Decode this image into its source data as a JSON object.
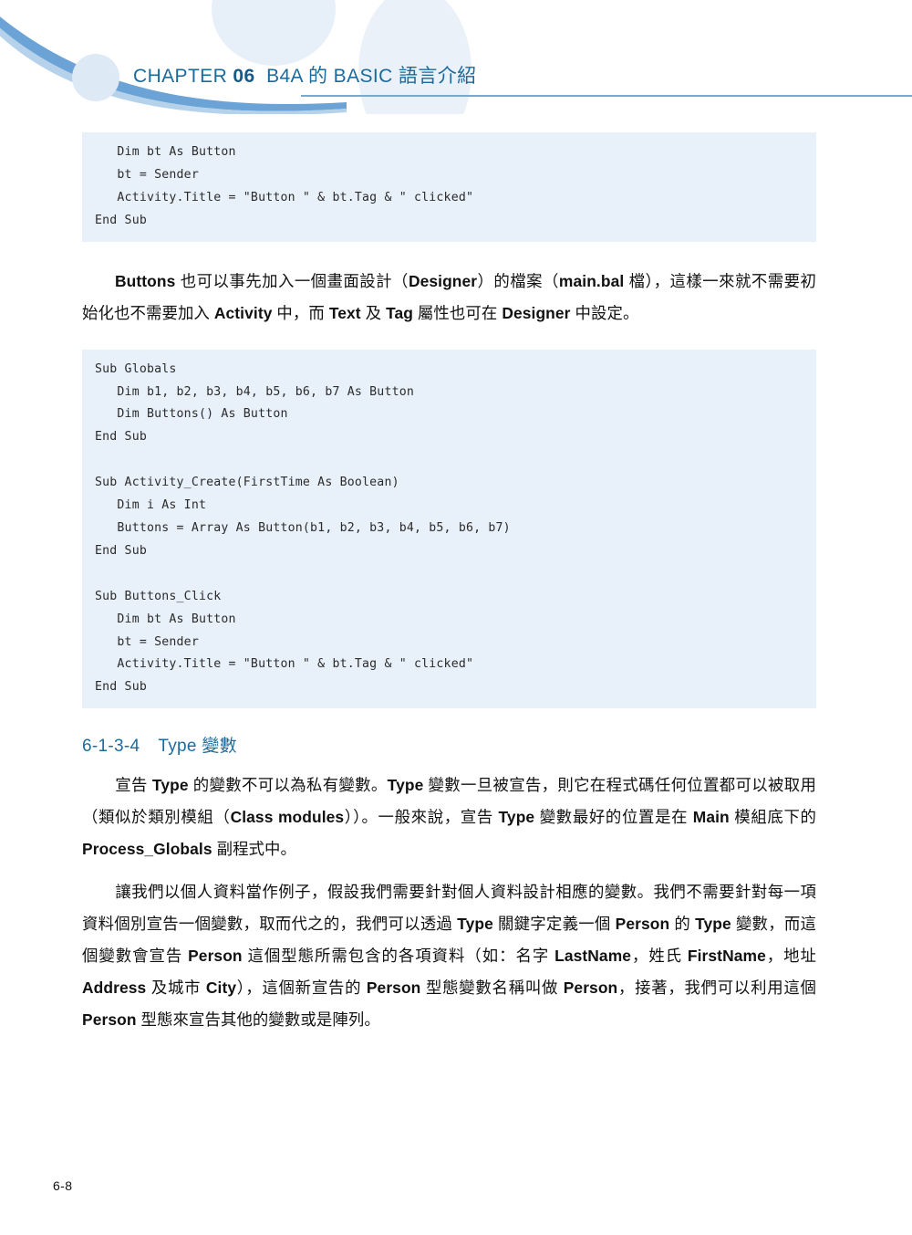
{
  "header": {
    "chapter_label": "CHAPTER",
    "chapter_number": "06",
    "chapter_title": "B4A 的 BASIC 語言介紹",
    "accent_color": "#1b6a9c",
    "rule_color": "#7ba9cc",
    "curve_color": "#6ba3d6",
    "circle_color": "#e3ecf6"
  },
  "code_block_1": {
    "background": "#e8f0f9",
    "lines": [
      "   Dim bt As Button",
      "   bt = Sender",
      "   Activity.Title = \"Button \" & bt.Tag & \" clicked\"",
      "End Sub"
    ]
  },
  "paragraph_1": {
    "segments": [
      {
        "text": "Buttons",
        "bold": true
      },
      {
        "text": " 也可以事先加入一個畫面設計（",
        "bold": false
      },
      {
        "text": "Designer",
        "bold": true
      },
      {
        "text": "）的檔案（",
        "bold": false
      },
      {
        "text": "main.bal",
        "bold": true
      },
      {
        "text": " 檔），這樣一來就不需要初始化也不需要加入 ",
        "bold": false
      },
      {
        "text": "Activity",
        "bold": true
      },
      {
        "text": " 中，而 ",
        "bold": false
      },
      {
        "text": "Text",
        "bold": true
      },
      {
        "text": " 及 ",
        "bold": false
      },
      {
        "text": "Tag",
        "bold": true
      },
      {
        "text": " 屬性也可在 ",
        "bold": false
      },
      {
        "text": "Designer",
        "bold": true
      },
      {
        "text": " 中設定。",
        "bold": false
      }
    ]
  },
  "code_block_2": {
    "background": "#e8f0f9",
    "lines": [
      "Sub Globals",
      "   Dim b1, b2, b3, b4, b5, b6, b7 As Button",
      "   Dim Buttons() As Button",
      "End Sub",
      "",
      "Sub Activity_Create(FirstTime As Boolean)",
      "   Dim i As Int",
      "   Buttons = Array As Button(b1, b2, b3, b4, b5, b6, b7)",
      "End Sub",
      "",
      "Sub Buttons_Click",
      "   Dim bt As Button",
      "   bt = Sender",
      "   Activity.Title = \"Button \" & bt.Tag & \" clicked\"",
      "End Sub"
    ]
  },
  "section_heading": {
    "number": "6-1-3-4",
    "title": "Type 變數"
  },
  "paragraph_2": {
    "segments": [
      {
        "text": "宣告 ",
        "bold": false
      },
      {
        "text": "Type",
        "bold": true
      },
      {
        "text": " 的變數不可以為私有變數。",
        "bold": false
      },
      {
        "text": "Type",
        "bold": true
      },
      {
        "text": " 變數一旦被宣告，則它在程式碼任何位置都可以被取用（類似於類別模組（",
        "bold": false
      },
      {
        "text": "Class modules",
        "bold": true
      },
      {
        "text": "））。一般來說，宣告 ",
        "bold": false
      },
      {
        "text": "Type",
        "bold": true
      },
      {
        "text": " 變數最好的位置是在 ",
        "bold": false
      },
      {
        "text": "Main",
        "bold": true
      },
      {
        "text": " 模組底下的 ",
        "bold": false
      },
      {
        "text": "Process_Globals",
        "bold": true
      },
      {
        "text": " 副程式中。",
        "bold": false
      }
    ]
  },
  "paragraph_3": {
    "segments": [
      {
        "text": "讓我們以個人資料當作例子，假設我們需要針對個人資料設計相應的變數。我們不需要針對每一項資料個別宣告一個變數，取而代之的，我們可以透過 ",
        "bold": false
      },
      {
        "text": "Type",
        "bold": true
      },
      {
        "text": " 關鍵字定義一個 ",
        "bold": false
      },
      {
        "text": "Person",
        "bold": true
      },
      {
        "text": " 的 ",
        "bold": false
      },
      {
        "text": "Type",
        "bold": true
      },
      {
        "text": " 變數，而這個變數會宣告 ",
        "bold": false
      },
      {
        "text": "Person",
        "bold": true
      },
      {
        "text": " 這個型態所需包含的各項資料（如：名字 ",
        "bold": false
      },
      {
        "text": "LastName",
        "bold": true
      },
      {
        "text": "，姓氏 ",
        "bold": false
      },
      {
        "text": "FirstName",
        "bold": true
      },
      {
        "text": "，地址 ",
        "bold": false
      },
      {
        "text": "Address",
        "bold": true
      },
      {
        "text": " 及城市 ",
        "bold": false
      },
      {
        "text": "City",
        "bold": true
      },
      {
        "text": "），這個新宣告的 ",
        "bold": false
      },
      {
        "text": "Person",
        "bold": true
      },
      {
        "text": " 型態變數名稱叫做 ",
        "bold": false
      },
      {
        "text": "Person",
        "bold": true
      },
      {
        "text": "，接著，我們可以利用這個 ",
        "bold": false
      },
      {
        "text": "Person",
        "bold": true
      },
      {
        "text": " 型態來宣告其他的變數或是陣列。",
        "bold": false
      }
    ]
  },
  "footer": {
    "page_number": "6-8"
  }
}
